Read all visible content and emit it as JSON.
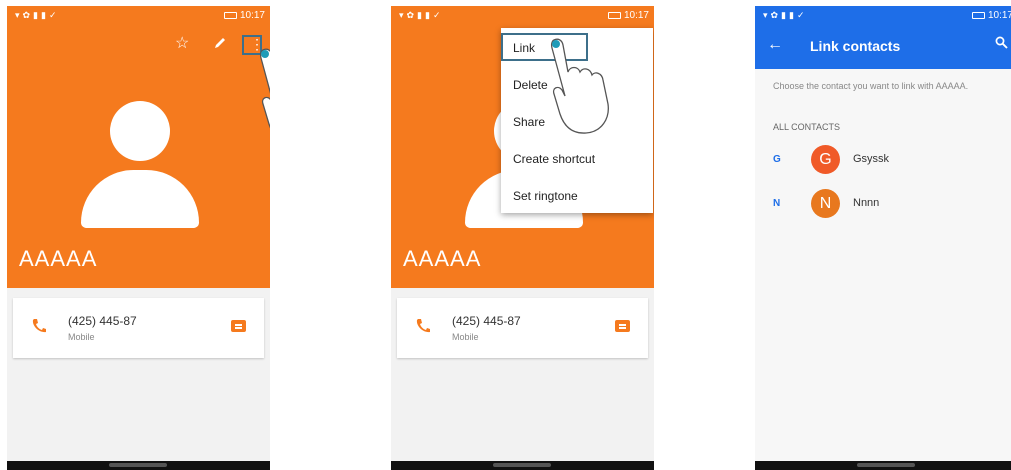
{
  "colors": {
    "primary_orange": "#f57a1e",
    "link_blue": "#1e6ee8",
    "gsyssk_avatar": "#f05a28",
    "nnnn_avatar": "#e8781e"
  },
  "status": {
    "time": "10:17"
  },
  "screen1": {
    "contact_name": "AAAAA",
    "phone_number": "(425) 445-87",
    "phone_type": "Mobile"
  },
  "screen2": {
    "contact_name": "AAAAA",
    "phone_number": "(425) 445-87",
    "phone_type": "Mobile",
    "menu": [
      "Link",
      "Delete",
      "Share",
      "Create shortcut",
      "Set ringtone"
    ]
  },
  "screen3": {
    "title": "Link contacts",
    "prompt": "Choose the contact you want to link with AAAAA.",
    "section_label": "ALL CONTACTS",
    "contacts": [
      {
        "letter": "G",
        "initial": "G",
        "name": "Gsyssk"
      },
      {
        "letter": "N",
        "initial": "N",
        "name": "Nnnn"
      }
    ]
  }
}
